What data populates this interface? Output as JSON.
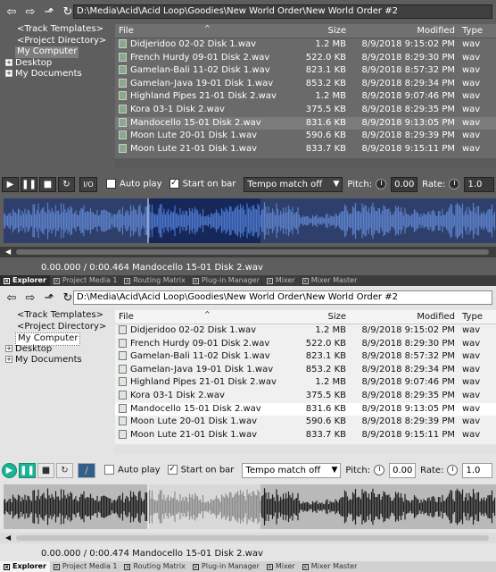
{
  "path": "D:\\Media\\Acid\\Acid Loop\\Goodies\\New World Order\\New World Order #2",
  "tree": [
    "<Track Templates>",
    "<Project Directory>",
    "My Computer",
    "Desktop",
    "My Documents"
  ],
  "columns": {
    "file": "File",
    "size": "Size",
    "modified": "Modified",
    "type": "Type"
  },
  "files": [
    {
      "name": "Didjeridoo 02-02 Disk 1.wav",
      "size": "1.2 MB",
      "modified": "8/9/2018 9:15:02 PM",
      "type": "wav"
    },
    {
      "name": "French Hurdy 09-01 Disk 2.wav",
      "size": "522.0 KB",
      "modified": "8/9/2018 8:29:30 PM",
      "type": "wav"
    },
    {
      "name": "Gamelan-Bali 11-02 Disk 1.wav",
      "size": "823.1 KB",
      "modified": "8/9/2018 8:57:32 PM",
      "type": "wav"
    },
    {
      "name": "Gamelan-Java 19-01 Disk 1.wav",
      "size": "853.2 KB",
      "modified": "8/9/2018 8:29:34 PM",
      "type": "wav"
    },
    {
      "name": "Highland Pipes 21-01 Disk 2.wav",
      "size": "1.2 MB",
      "modified": "8/9/2018 9:07:46 PM",
      "type": "wav"
    },
    {
      "name": "Kora 03-1 Disk 2.wav",
      "size": "375.5 KB",
      "modified": "8/9/2018 8:29:35 PM",
      "type": "wav"
    },
    {
      "name": "Mandocello 15-01 Disk 2.wav",
      "size": "831.6 KB",
      "modified": "8/9/2018 9:13:05 PM",
      "type": "wav"
    },
    {
      "name": "Moon Lute 20-01 Disk 1.wav",
      "size": "590.6 KB",
      "modified": "8/9/2018 8:29:39 PM",
      "type": "wav"
    },
    {
      "name": "Moon Lute 21-01 Disk 1.wav",
      "size": "833.7 KB",
      "modified": "8/9/2018 9:15:11 PM",
      "type": "wav"
    }
  ],
  "transport": {
    "auto_play": "Auto play",
    "start_on_bar": "Start on bar",
    "tempo": "Tempo match off",
    "pitch_label": "Pitch:",
    "pitch_value": "0.00",
    "rate_label": "Rate:",
    "rate_value": "1.0"
  },
  "dark": {
    "io_label": "I/O",
    "status": "0.00.000 / 0:00.464  Mandocello 15-01 Disk 2.wav"
  },
  "light": {
    "status": "0.00.000 / 0:00.474  Mandocello 15-01 Disk 2.wav"
  },
  "tabs": [
    "Explorer",
    "Project Media 1",
    "Routing Matrix",
    "Plug-in Manager",
    "Mixer",
    "Mixer Master"
  ],
  "colors": {
    "dark_bg": "#5e5e5e",
    "light_bg": "#e4e4e4",
    "wave_blue": "#4b6aa8",
    "wave_sel": "#1e3c82",
    "accent_green": "#1ab394"
  }
}
